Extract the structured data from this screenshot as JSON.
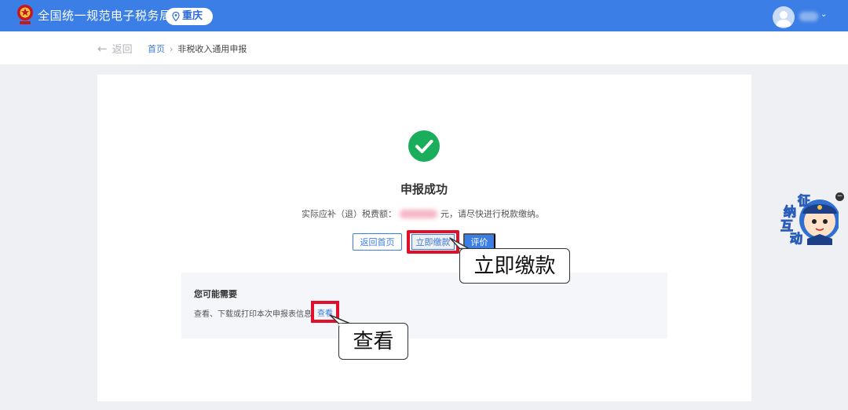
{
  "header": {
    "site_title": "全国统一规范电子税务局",
    "region": "重庆",
    "emblem_icon": "tax-emblem-icon",
    "user_avatar_icon": "user-avatar-icon",
    "user_menu_icon": "chevron-down-icon",
    "user_menu_glyph": "⌄"
  },
  "subbar": {
    "back_arrow": "←",
    "back_label": "返回",
    "breadcrumb_home": "首页",
    "breadcrumb_separator": "›",
    "breadcrumb_current": "非税收入通用申报"
  },
  "result": {
    "status_icon": "check-circle-icon",
    "title": "申报成功",
    "fee_prefix": "实际应补（退）税费额：",
    "fee_suffix": "元，请尽快进行税款缴纳。"
  },
  "actions": {
    "home_label": "返回首页",
    "pay_label": "立即缴款",
    "rate_label": "评价"
  },
  "annotations": {
    "pay_callout": "立即缴款",
    "view_callout": "查看"
  },
  "hint": {
    "title": "您可能需要",
    "text": "查看、下载或打印本次申报表信息",
    "link_label": "查看"
  },
  "mascot": {
    "chars": [
      "征",
      "纳",
      "互",
      "动"
    ],
    "close_glyph": "−"
  },
  "colors": {
    "brand_blue": "#3b7ee5",
    "highlight_red": "#e0102d",
    "success_green": "#1aad5c"
  }
}
